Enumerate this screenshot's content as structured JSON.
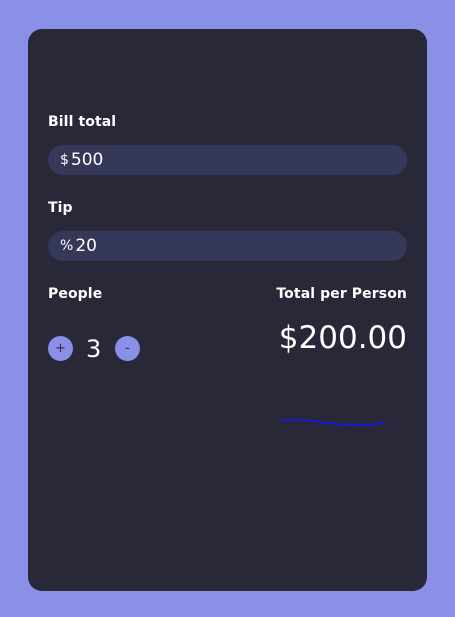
{
  "bill": {
    "label": "Bill total",
    "prefix": "$",
    "value": "500"
  },
  "tip": {
    "label": "Tip",
    "prefix": "%",
    "value": "20"
  },
  "people": {
    "label": "People",
    "increment_label": "+",
    "count": "3",
    "decrement_label": "-"
  },
  "result": {
    "label": "Total per Person",
    "value": "$200.00"
  },
  "colors": {
    "background": "#8a8fe8",
    "card": "#282839",
    "field": "#36385a",
    "accent": "#8a8fe8",
    "scribble": "#1a1ad0"
  }
}
